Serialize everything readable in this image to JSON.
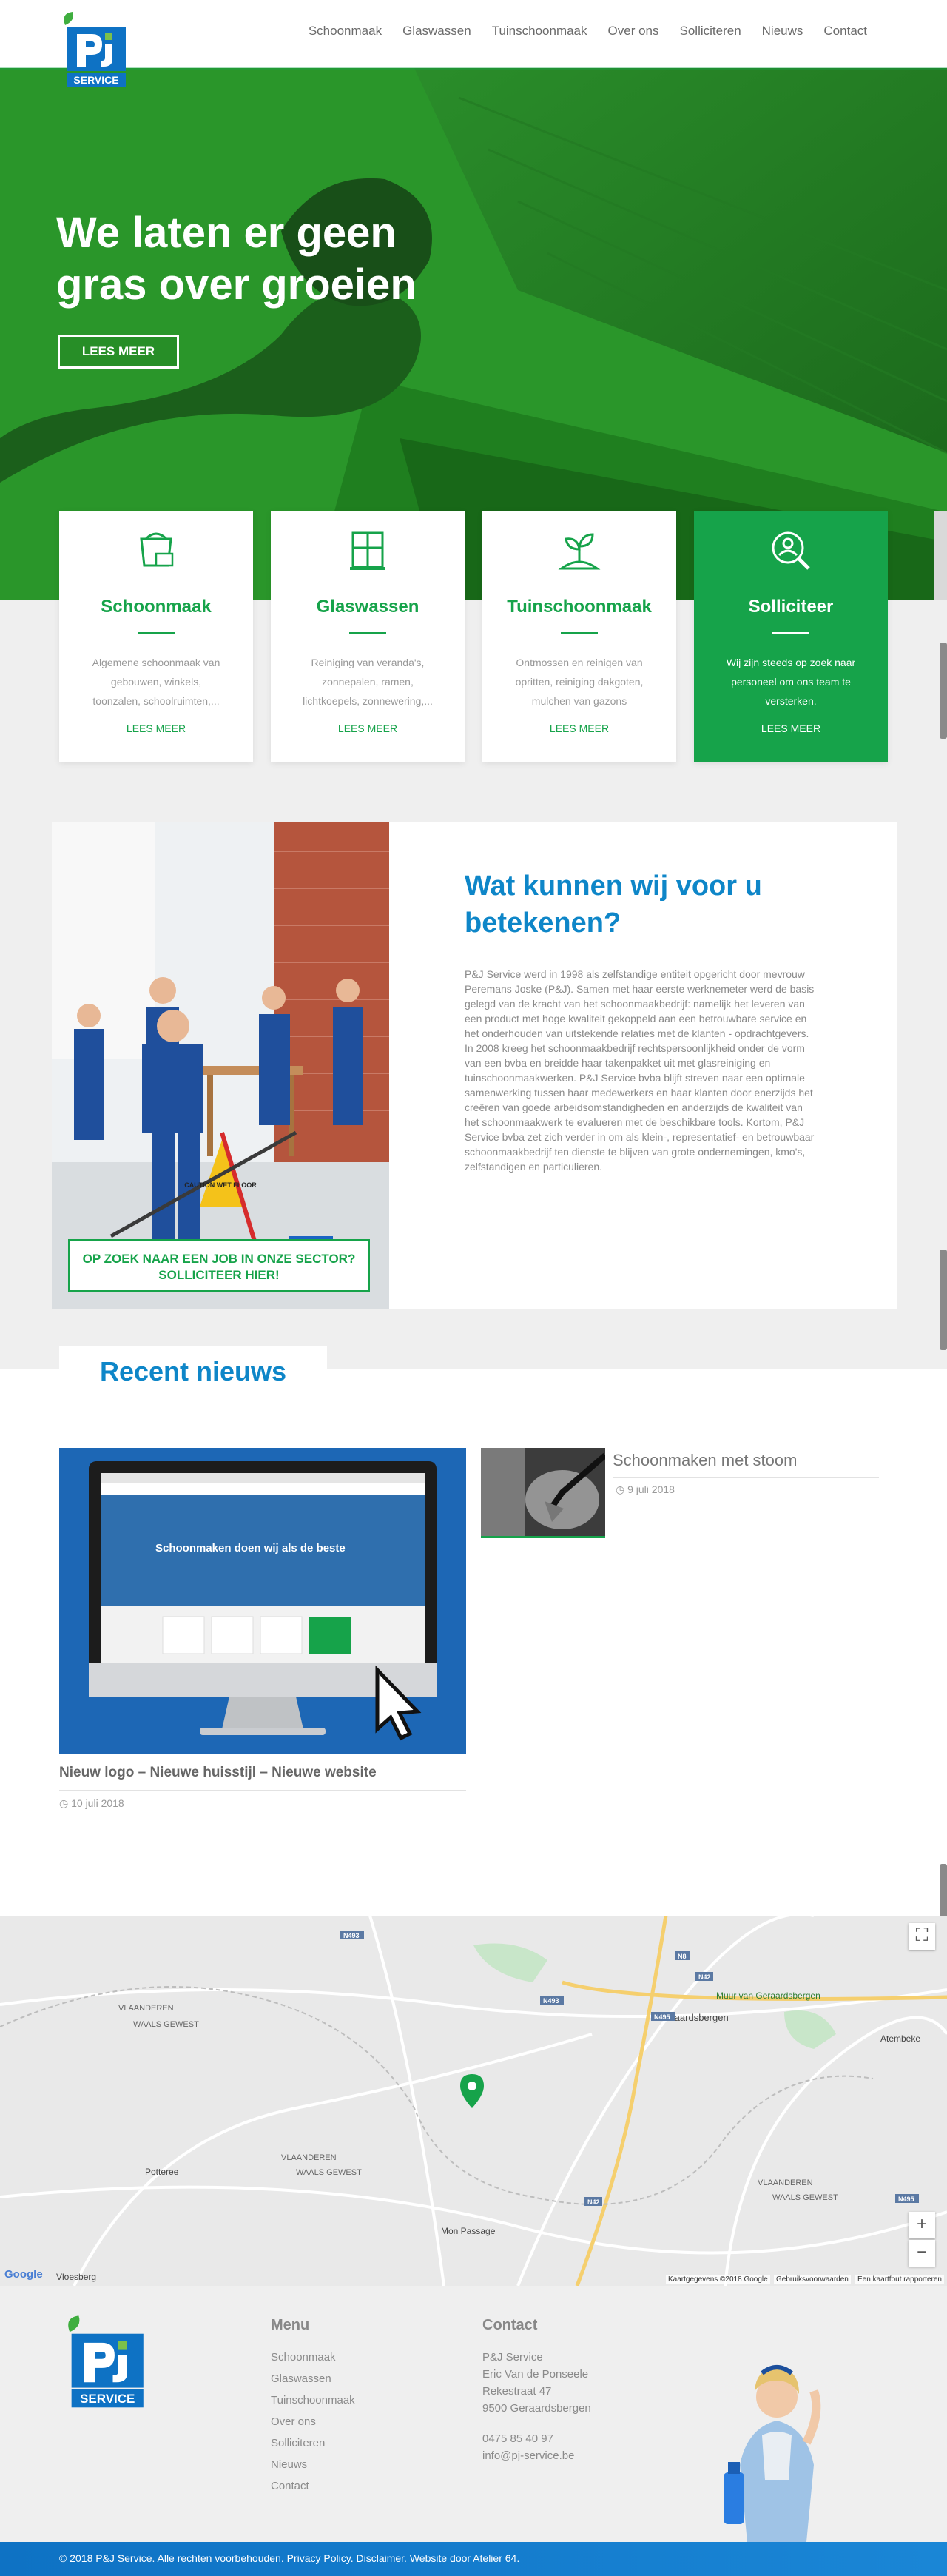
{
  "brand": {
    "logo_text": "SERVICE",
    "primary": "#16a34a",
    "accent_blue": "#0e86c8"
  },
  "nav": {
    "items": [
      "Schoonmaak",
      "Glaswassen",
      "Tuinschoonmaak",
      "Over ons",
      "Solliciteren",
      "Nieuws",
      "Contact"
    ]
  },
  "hero": {
    "title": "We laten er geen gras over groeien",
    "button": "LEES MEER"
  },
  "services": [
    {
      "icon": "bucket-icon",
      "title": "Schoonmaak",
      "desc": "Algemene schoonmaak van gebouwen, winkels, toonzalen, schoolruimten,...",
      "more": "LEES MEER"
    },
    {
      "icon": "window-icon",
      "title": "Glaswassen",
      "desc": "Reiniging van veranda's, zonnepalen, ramen, lichtkoepels, zonnewering,...",
      "more": "LEES MEER"
    },
    {
      "icon": "plant-icon",
      "title": "Tuinschoonmaak",
      "desc": "Ontmossen en reinigen van opritten, reiniging dakgoten, mulchen van gazons",
      "more": "LEES MEER"
    },
    {
      "icon": "search-person-icon",
      "title": "Solliciteer",
      "desc": "Wij zijn steeds op zoek naar personeel om ons team te versterken.",
      "more": "LEES MEER"
    }
  ],
  "about": {
    "title": "Wat kunnen wij voor u betekenen?",
    "text": "P&J Service werd in 1998 als zelfstandige entiteit opgericht door mevrouw Peremans Joske (P&J). Samen met haar eerste werknemeter werd de basis gelegd van de kracht van het schoonmaakbedrijf: namelijk het leveren van een product met hoge kwaliteit gekoppeld aan een betrouwbare service en het onderhouden van uitstekende relaties met de klanten - opdrachtgevers. In 2008 kreeg het schoonmaakbedrijf rechtspersoonlijkheid onder de vorm van een bvba en breidde haar takenpakket uit met glasreiniging en tuinschoonmaakwerken. P&J Service bvba blijft streven naar een optimale samenwerking tussen haar medewerkers en haar klanten door enerzijds het creëren van goede arbeidsomstandigheden en anderzijds de kwaliteit van het schoonmaakwerk te evalueren met de beschikbare tools. Kortom, P&J Service bvba zet zich verder in om als klein-, representatief- en betrouwbaar schoonmaakbedrijf ten dienste te blijven van grote ondernemingen, kmo's, zelfstandigen en particulieren.",
    "cta": "OP ZOEK NAAR EEN JOB IN ONZE SECTOR? SOLLICITEER HIER!",
    "sign_text": "CAUTION WET FLOOR"
  },
  "news": {
    "heading": "Recent nieuws",
    "main": {
      "title": "Nieuw logo – Nieuwe huisstijl – Nieuwe website",
      "date": "10 juli 2018",
      "screen_title": "Schoonmaken doen wij als de beste"
    },
    "side": {
      "title": "Schoonmaken met stoom",
      "date": "9 juli 2018"
    }
  },
  "map": {
    "labels": [
      "VLAANDEREN",
      "WAALS GEWEST",
      "Geraardsbergen",
      "Muur van Geraardsbergen",
      "Atembeke",
      "Vloesberg",
      "Potteree",
      "Mon Passage",
      "VLAANDEREN",
      "WAALS GEWEST",
      "VLAANDEREN",
      "WAALS GEWEST"
    ],
    "roads": [
      "N493",
      "N493",
      "N42",
      "N495",
      "N8",
      "N42",
      "N495"
    ],
    "attribution": [
      "Kaartgegevens ©2018 Google",
      "Gebruiksvoorwaarden",
      "Een kaartfout rapporteren"
    ],
    "google": "Google",
    "zoom_in": "+",
    "zoom_out": "−"
  },
  "footer": {
    "menu_heading": "Menu",
    "menu": [
      "Schoonmaak",
      "Glaswassen",
      "Tuinschoonmaak",
      "Over ons",
      "Solliciteren",
      "Nieuws",
      "Contact"
    ],
    "contact_heading": "Contact",
    "contact": [
      "P&J Service",
      "Eric Van de Ponseele",
      "Rekestraat 47",
      "9500 Geraardsbergen"
    ],
    "phone": "0475 85 40 97",
    "email": "info@pj-service.be",
    "copyright": "© 2018 P&J Service. Alle rechten voorbehouden. Privacy Policy. Disclaimer. Website door Atelier 64."
  }
}
